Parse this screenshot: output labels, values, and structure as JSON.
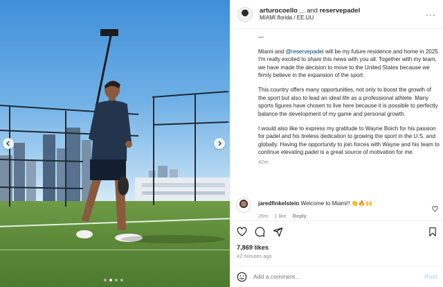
{
  "header": {
    "username": "arturocoello__",
    "connector": "and",
    "collaborator": "reservepadel",
    "location": "MIAMI florida / EE.UU",
    "more_label": "···"
  },
  "caption": {
    "dash": "—",
    "p1_before": "Miami and ",
    "p1_mention": "@reservepadel",
    "p1_after": " will be my future residence and home in 2025. I'm really excited to share this news with you all. Together with my team, we have made the decision to move to the United States because we firmly believe in the expansion of the sport.",
    "p2": "This country offers many opportunities, not only to boost the growth of the sport but also to lead an ideal life as a professional athlete. Many sports figures have chosen to live here because it is possible to perfectly balance the development of my game and personal growth.",
    "p3": "I would also like to express my gratitude to Wayne Boich for his passion for padel and his tireless dedication to growing the sport in the U.S. and globally. Having the opportunity to join forces with Wayne and his team to continue elevating padel is a great source of motivation for me.",
    "time": "42m"
  },
  "comment": {
    "username": "jaredfinkelstein",
    "text": "Welcome to Miami!! 👏🔥🙌",
    "time": "26m",
    "likes": "1 like",
    "reply": "Reply"
  },
  "post": {
    "likes": "7,869 likes",
    "ago": "42 minutes ago"
  },
  "composer": {
    "placeholder": "Add a comment...",
    "post_label": "Post"
  },
  "carousel": {
    "slides": 4,
    "active": 1
  },
  "icons": {
    "like": "heart-icon",
    "comment": "comment-icon",
    "share": "share-icon",
    "save": "bookmark-icon",
    "emoji": "emoji-icon",
    "prev": "chevron-left-icon",
    "next": "chevron-right-icon",
    "more": "more-icon"
  },
  "colors": {
    "mention": "#00376b",
    "post_button": "#b3dbff",
    "muted": "#8e8e8e"
  }
}
